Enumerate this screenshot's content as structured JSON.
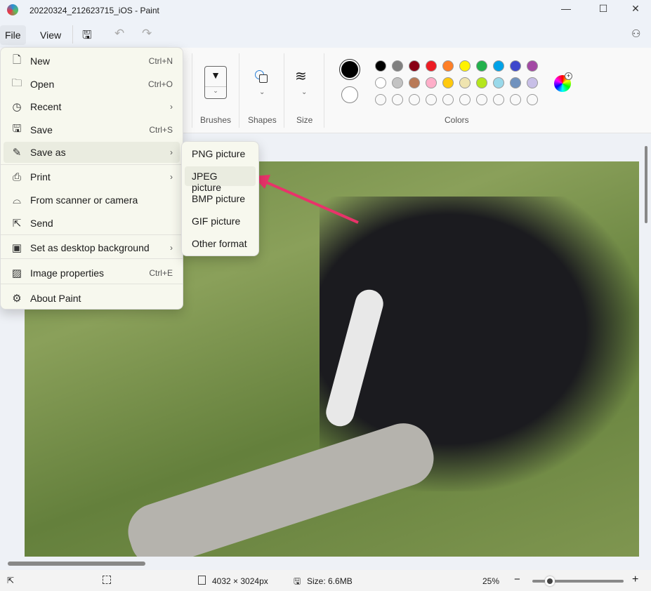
{
  "window": {
    "title": "20220324_212623715_iOS - Paint",
    "minimize": "—",
    "maximize": "☐",
    "close": "✕"
  },
  "menubar": {
    "file": "File",
    "view": "View"
  },
  "ribbon": {
    "brushes": "Brushes",
    "shapes": "Shapes",
    "size": "Size",
    "colors": "Colors",
    "primary_color": "#000000",
    "secondary_color": "#ffffff",
    "palette_row1": [
      "#000000",
      "#808080",
      "#880015",
      "#ed1c24",
      "#ff7f27",
      "#fff200",
      "#22b14c",
      "#00a2e8",
      "#3f48cc",
      "#a349a4"
    ],
    "palette_row2": [
      "#ffffff",
      "#c3c3c3",
      "#b97a57",
      "#ffaec9",
      "#ffc90e",
      "#efe4b0",
      "#b5e61d",
      "#99d9ea",
      "#7092be",
      "#c8bfe7"
    ]
  },
  "file_menu": {
    "items": [
      {
        "icon": "new-file-icon",
        "glyph": "🗋",
        "label": "New",
        "shortcut": "Ctrl+N"
      },
      {
        "icon": "folder-icon",
        "glyph": "🗀",
        "label": "Open",
        "shortcut": "Ctrl+O"
      },
      {
        "icon": "clock-icon",
        "glyph": "◷",
        "label": "Recent",
        "shortcut": "›"
      },
      {
        "icon": "save-icon",
        "glyph": "🖫",
        "label": "Save",
        "shortcut": "Ctrl+S"
      },
      {
        "icon": "save-as-icon",
        "glyph": "✎",
        "label": "Save as",
        "shortcut": "›"
      },
      {
        "icon": "printer-icon",
        "glyph": "⎙",
        "label": "Print",
        "shortcut": "›"
      },
      {
        "icon": "scanner-icon",
        "glyph": "⌓",
        "label": "From scanner or camera",
        "shortcut": ""
      },
      {
        "icon": "send-icon",
        "glyph": "⇱",
        "label": "Send",
        "shortcut": ""
      },
      {
        "icon": "desktop-icon",
        "glyph": "▣",
        "label": "Set as desktop background",
        "shortcut": "›"
      },
      {
        "icon": "image-properties-icon",
        "glyph": "▨",
        "label": "Image properties",
        "shortcut": "Ctrl+E"
      },
      {
        "icon": "gear-icon",
        "glyph": "⚙",
        "label": "About Paint",
        "shortcut": ""
      }
    ]
  },
  "save_as_menu": {
    "items": [
      "PNG picture",
      "JPEG picture",
      "BMP picture",
      "GIF picture",
      "Other format"
    ]
  },
  "status": {
    "dimensions": "4032 × 3024px",
    "size": "Size: 6.6MB",
    "zoom": "25%",
    "zoom_level_percent": 25
  }
}
